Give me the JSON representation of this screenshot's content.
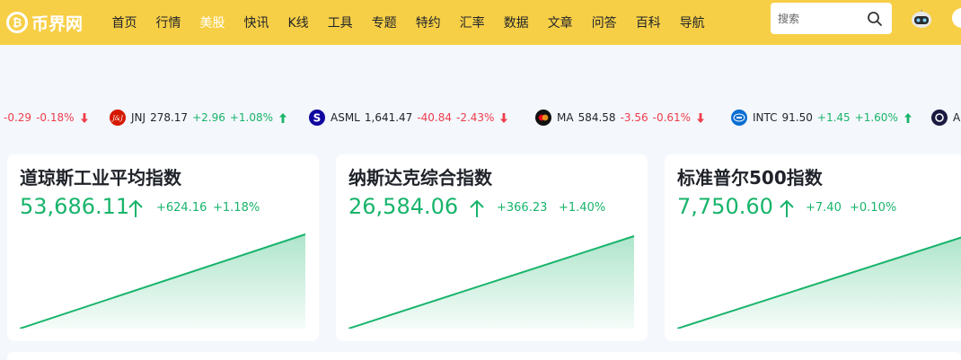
{
  "header": {
    "logo_text": "币界网",
    "nav": [
      "首页",
      "行情",
      "美股",
      "快讯",
      "K线",
      "工具",
      "专题",
      "特约",
      "汇率",
      "数据",
      "文章",
      "问答",
      "百科",
      "导航"
    ],
    "active_nav": "美股",
    "search_placeholder": "搜索"
  },
  "ticker": [
    {
      "symbol": "",
      "price": "",
      "change": "-0.29",
      "pct": "-0.18%",
      "dir": "down",
      "logo": "",
      "logo_color": ""
    },
    {
      "symbol": "JNJ",
      "price": "278.17",
      "change": "+2.96",
      "pct": "+1.08%",
      "dir": "up",
      "logo": "jnj-logo-icon",
      "logo_color": "#d51900"
    },
    {
      "symbol": "ASML",
      "price": "1,641.47",
      "change": "-40.84",
      "pct": "-2.43%",
      "dir": "down",
      "logo": "asml-logo-icon",
      "logo_color": "#10069f"
    },
    {
      "symbol": "MA",
      "price": "584.58",
      "change": "-3.56",
      "pct": "-0.61%",
      "dir": "down",
      "logo": "mastercard-logo-icon",
      "logo_color": "#111111"
    },
    {
      "symbol": "INTC",
      "price": "91.50",
      "change": "+1.45",
      "pct": "+1.60%",
      "dir": "up",
      "logo": "intel-logo-icon",
      "logo_color": "#0a6ed1"
    },
    {
      "symbol": "A",
      "price": "",
      "change": "",
      "pct": "",
      "dir": "up",
      "logo": "ring-logo-icon",
      "logo_color": "#1a1a40"
    }
  ],
  "indices": [
    {
      "name": "道琼斯工业平均指数",
      "value": "53,686.11",
      "change": "+624.16",
      "pct": "+1.18%",
      "trend": "up"
    },
    {
      "name": "纳斯达克综合指数",
      "value": "26,584.06",
      "change": "+366.23",
      "pct": "+1.40%",
      "trend": "up"
    },
    {
      "name": "标准普尔500指数",
      "value": "7,750.60",
      "change": "+7.40",
      "pct": "+0.10%",
      "trend": "up"
    }
  ],
  "colors": {
    "brand": "#f7cf46",
    "up": "#18b46b",
    "down": "#ee3d4d"
  }
}
